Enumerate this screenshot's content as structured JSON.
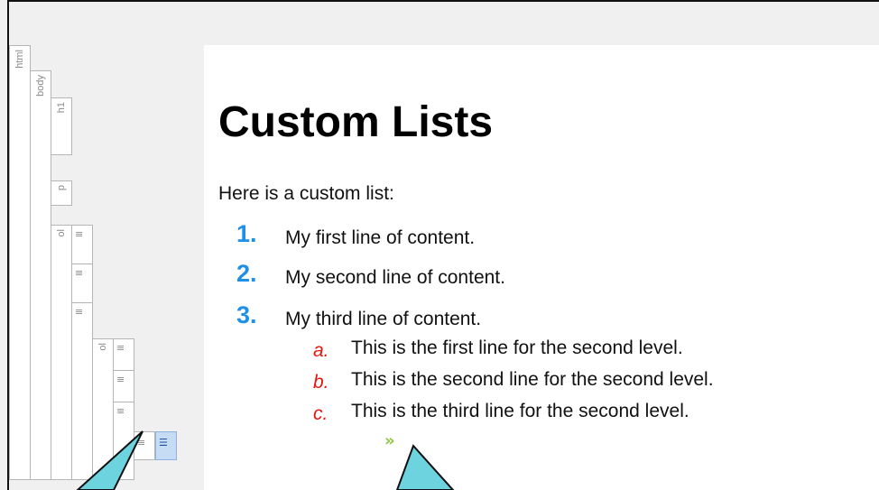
{
  "structure_bar": {
    "tags": {
      "html": "html",
      "body": "body",
      "h1": "h1",
      "p": "p",
      "ol1": "ol",
      "ol2": "ol"
    },
    "li_glyph": "≡",
    "li_active_glyph": "☰"
  },
  "document": {
    "heading": "Custom Lists",
    "intro": "Here is a custom list:",
    "list": [
      {
        "marker": "1.",
        "text": "My first line of content."
      },
      {
        "marker": "2.",
        "text": "My second line of content."
      },
      {
        "marker": "3.",
        "text": "My third line of content."
      }
    ],
    "sublist": [
      {
        "marker": "a.",
        "text": "This is the first line for the second level."
      },
      {
        "marker": "b.",
        "text": "This is the second line for the second level."
      },
      {
        "marker": "c.",
        "text": "This is the third line for the second level."
      }
    ],
    "cursor_glyph": "»"
  },
  "colors": {
    "number_marker": "#1e90e8",
    "alpha_marker": "#e8150e",
    "chevron": "#8dc63f",
    "callout": "#6dd3df",
    "active_li": "#c6dcf5"
  }
}
